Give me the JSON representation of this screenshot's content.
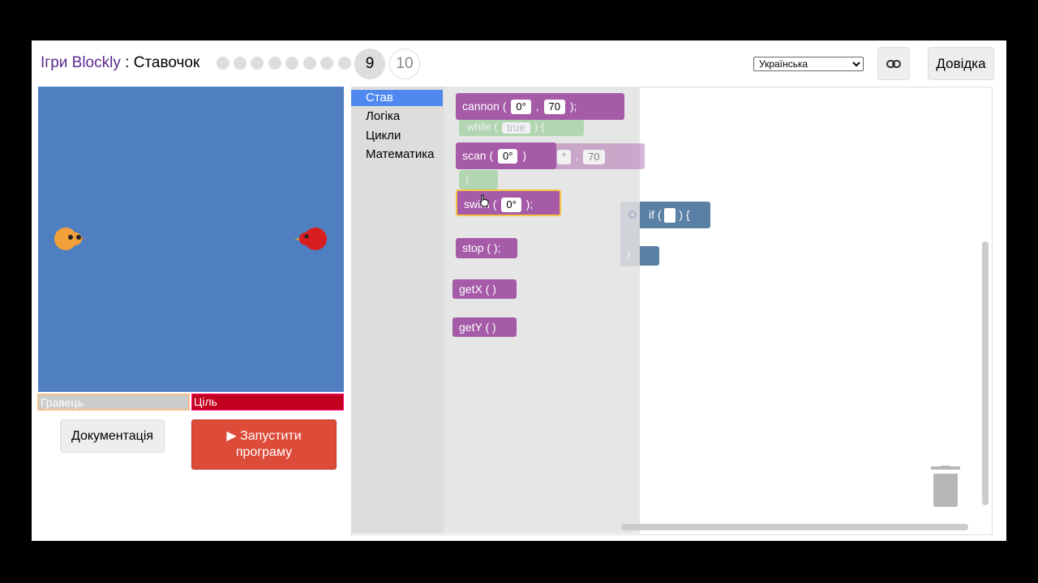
{
  "header": {
    "app_name": "Ігри Blockly",
    "separator": " : ",
    "game_name": "Ставочок",
    "levels": {
      "completed": [
        1,
        2,
        3,
        4,
        5,
        6,
        7,
        8
      ],
      "current": "9",
      "next": "10"
    },
    "language": "Українська",
    "link_icon": "link-icon",
    "help_label": "Довідка"
  },
  "status_bars": {
    "player": "Гравець",
    "target": "Ціль"
  },
  "buttons": {
    "documentation": "Документація",
    "run_line1": "Запустити",
    "run_line2": "програму",
    "run_icon": "play-icon"
  },
  "toolbox": {
    "categories": [
      "Став",
      "Логіка",
      "Цикли",
      "Математика"
    ]
  },
  "flyout": {
    "cannon": {
      "name": "cannon",
      "open": "(",
      "angle": "0°",
      "comma": ",",
      "range": "70",
      "close": ");"
    },
    "scan": {
      "name": "scan",
      "open": "(",
      "angle": "0°",
      "close": ")"
    },
    "swim": {
      "name": "swim",
      "open": "(",
      "angle": "0°",
      "close": ");"
    },
    "stop": {
      "name": "stop",
      "args": "( );"
    },
    "getx": {
      "name": "getX",
      "args": "( )"
    },
    "gety": {
      "name": "getY",
      "args": "( )"
    },
    "ghost_while": {
      "keyword": "while (",
      "value": "true",
      "end": ") {",
      "close": "}"
    },
    "ghost_cannon": {
      "angle": "°",
      "comma": ",",
      "range": "70"
    }
  },
  "workspace": {
    "if_block": {
      "label": "if (",
      "end": ") {",
      "close": "}"
    }
  },
  "colors": {
    "arena": "#4f7fc0",
    "stav_block": "#a55ba8",
    "logic_block": "#5b80a5",
    "run_button": "#dd4b39",
    "selected_category": "#4f89f0"
  },
  "icons": {
    "trash": "trash-icon",
    "gear": "gear-icon",
    "hand_cursor": "hand-cursor-icon"
  }
}
